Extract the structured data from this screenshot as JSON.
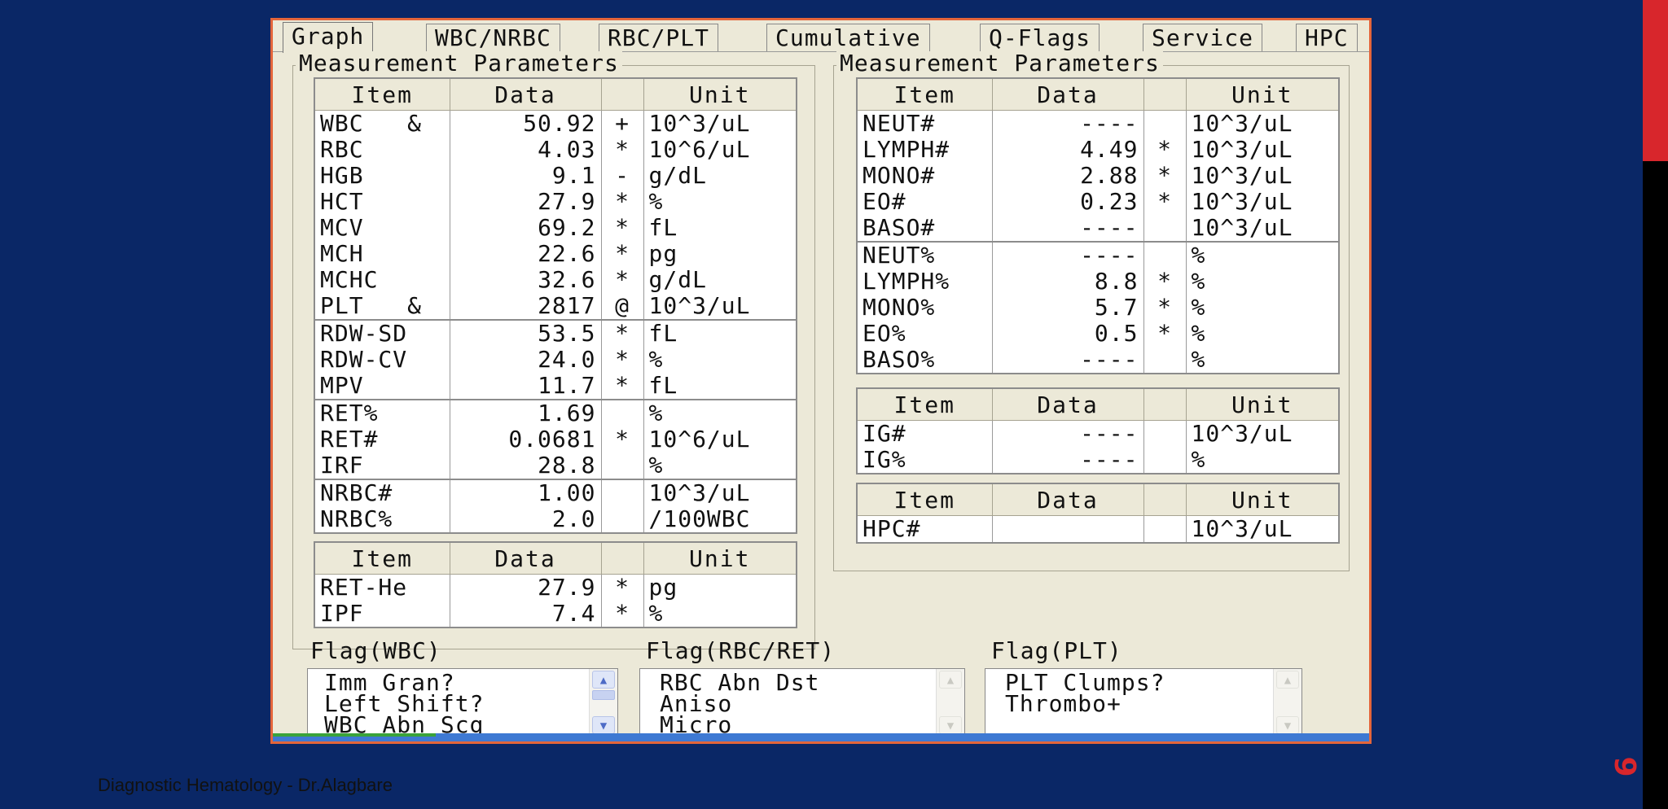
{
  "tabs": [
    "Graph",
    "WBC/NRBC",
    "RBC/PLT",
    "Cumulative",
    "Q-Flags",
    "Service",
    "HPC"
  ],
  "left_group_title": "Measurement Parameters",
  "right_group_title": "Measurement Parameters",
  "headers": {
    "item": "Item",
    "data": "Data",
    "flag": "",
    "unit": "Unit"
  },
  "left_main_rows": [
    {
      "item": "WBC   &",
      "data": "50.92",
      "flag": "+",
      "unit": "10^3/uL"
    },
    {
      "item": "RBC",
      "data": "4.03",
      "flag": "*",
      "unit": "10^6/uL"
    },
    {
      "item": "HGB",
      "data": "9.1",
      "flag": "-",
      "unit": "g/dL"
    },
    {
      "item": "HCT",
      "data": "27.9",
      "flag": "*",
      "unit": "%"
    },
    {
      "item": "MCV",
      "data": "69.2",
      "flag": "*",
      "unit": "fL"
    },
    {
      "item": "MCH",
      "data": "22.6",
      "flag": "*",
      "unit": "pg"
    },
    {
      "item": "MCHC",
      "data": "32.6",
      "flag": "*",
      "unit": "g/dL"
    },
    {
      "item": "PLT   &",
      "data": "2817",
      "flag": "@",
      "unit": "10^3/uL"
    },
    {
      "item": "RDW-SD",
      "data": "53.5",
      "flag": "*",
      "unit": "fL",
      "sep": true
    },
    {
      "item": "RDW-CV",
      "data": "24.0",
      "flag": "*",
      "unit": "%"
    },
    {
      "item": "MPV",
      "data": "11.7",
      "flag": "*",
      "unit": "fL"
    },
    {
      "item": "RET%",
      "data": "1.69",
      "flag": "",
      "unit": "%",
      "sep": true
    },
    {
      "item": "RET#",
      "data": "0.0681",
      "flag": "*",
      "unit": "10^6/uL"
    },
    {
      "item": "IRF",
      "data": "28.8",
      "flag": "",
      "unit": "%"
    },
    {
      "item": "NRBC#",
      "data": "1.00",
      "flag": "",
      "unit": "10^3/uL",
      "sep": true
    },
    {
      "item": "NRBC%",
      "data": "2.0",
      "flag": "",
      "unit": "/100WBC"
    }
  ],
  "left_ret_rows": [
    {
      "item": "RET-He",
      "data": "27.9",
      "flag": "*",
      "unit": "pg"
    },
    {
      "item": "IPF",
      "data": "7.4",
      "flag": "*",
      "unit": "%"
    }
  ],
  "right_main_rows": [
    {
      "item": "NEUT#",
      "data": "----",
      "flag": "",
      "unit": "10^3/uL"
    },
    {
      "item": "LYMPH#",
      "data": "4.49",
      "flag": "*",
      "unit": "10^3/uL"
    },
    {
      "item": "MONO#",
      "data": "2.88",
      "flag": "*",
      "unit": "10^3/uL"
    },
    {
      "item": "EO#",
      "data": "0.23",
      "flag": "*",
      "unit": "10^3/uL"
    },
    {
      "item": "BASO#",
      "data": "----",
      "flag": "",
      "unit": "10^3/uL"
    },
    {
      "item": "NEUT%",
      "data": "----",
      "flag": "",
      "unit": "%",
      "sep": true
    },
    {
      "item": "LYMPH%",
      "data": "8.8",
      "flag": "*",
      "unit": "%"
    },
    {
      "item": "MONO%",
      "data": "5.7",
      "flag": "*",
      "unit": "%"
    },
    {
      "item": "EO%",
      "data": "0.5",
      "flag": "*",
      "unit": "%"
    },
    {
      "item": "BASO%",
      "data": "----",
      "flag": "",
      "unit": "%"
    }
  ],
  "right_ig_rows": [
    {
      "item": "IG#",
      "data": "----",
      "flag": "",
      "unit": "10^3/uL"
    },
    {
      "item": "IG%",
      "data": "----",
      "flag": "",
      "unit": "%"
    }
  ],
  "right_hpc_rows": [
    {
      "item": "HPC#",
      "data": "",
      "flag": "",
      "unit": "10^3/uL"
    }
  ],
  "flags": {
    "wbc": {
      "label": "Flag(WBC)",
      "items": [
        "Imm Gran?",
        "Left Shift?",
        "WBC Abn Scg"
      ]
    },
    "rbc": {
      "label": "Flag(RBC/RET)",
      "items": [
        "RBC Abn Dst",
        "Aniso",
        "Micro"
      ]
    },
    "plt": {
      "label": "Flag(PLT)",
      "items": [
        "PLT Clumps?",
        "Thrombo+"
      ]
    }
  },
  "footer": "Diagnostic Hematology - Dr.Alagbare",
  "slide_number": "9",
  "colors": {
    "slide_bg": "#0a2766",
    "accent_red": "#d8262c",
    "window_border": "#e4653a",
    "window_bg": "#ece9d8"
  },
  "icons": {
    "scroll_up": "chevron-up-icon",
    "scroll_down": "chevron-down-icon"
  }
}
